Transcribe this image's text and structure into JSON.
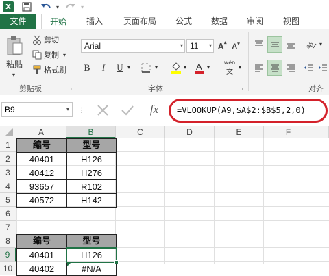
{
  "ribbon_tabs": [
    "文件",
    "开始",
    "插入",
    "页面布局",
    "公式",
    "数据",
    "审阅",
    "视图"
  ],
  "clipboard": {
    "paste": "粘贴",
    "cut": "剪切",
    "copy": "复制",
    "format_painter": "格式刷",
    "group": "剪贴板"
  },
  "font": {
    "name": "Arial",
    "size": "11",
    "group": "字体",
    "bold": "B",
    "italic": "I",
    "underline": "U",
    "wen": "wén"
  },
  "alignment": {
    "group": "对齐方"
  },
  "namebox": "B9",
  "formula": "=VLOOKUP(A9,$A$2:$B$5,2,0)",
  "fx": "fx",
  "columns": [
    "A",
    "B",
    "C",
    "D",
    "E",
    "F"
  ],
  "rows": [
    "1",
    "2",
    "3",
    "4",
    "5",
    "6",
    "7",
    "8",
    "9",
    "10"
  ],
  "table1": {
    "headers": [
      "编号",
      "型号"
    ],
    "rows": [
      [
        "40401",
        "H126"
      ],
      [
        "40412",
        "H276"
      ],
      [
        "93657",
        "R102"
      ],
      [
        "40572",
        "H142"
      ]
    ]
  },
  "table2": {
    "headers": [
      "编号",
      "型号"
    ],
    "rows": [
      [
        "40401",
        "H126"
      ],
      [
        "40402",
        "#N/A"
      ]
    ]
  },
  "colors": {
    "accent": "#217346",
    "header_fill": "#a6a6a6",
    "highlight": "#d4212a"
  }
}
